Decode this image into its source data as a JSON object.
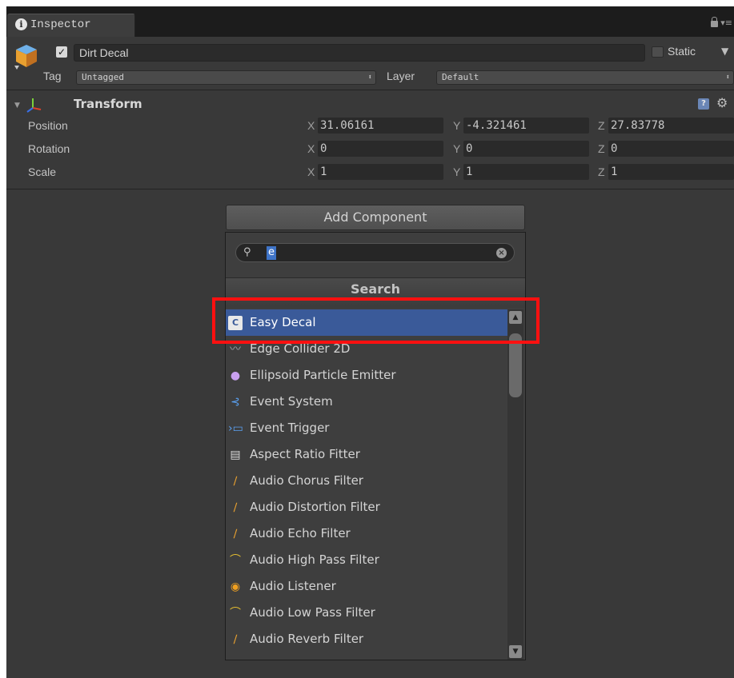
{
  "tab": {
    "title": "Inspector",
    "icon": "info-icon"
  },
  "object": {
    "name": "Dirt Decal",
    "active": true,
    "static_label": "Static",
    "static_checked": false
  },
  "tag": {
    "label": "Tag",
    "value": "Untagged"
  },
  "layer": {
    "label": "Layer",
    "value": "Default"
  },
  "transform": {
    "title": "Transform",
    "rows": [
      {
        "label": "Position",
        "x": "31.06161",
        "y": "-4.321461",
        "z": "27.83778"
      },
      {
        "label": "Rotation",
        "x": "0",
        "y": "0",
        "z": "0"
      },
      {
        "label": "Scale",
        "x": "1",
        "y": "1",
        "z": "1"
      }
    ],
    "axes": [
      "X",
      "Y",
      "Z"
    ]
  },
  "add_component": {
    "button_label": "Add Component",
    "search_value": "e",
    "header": "Search",
    "results": [
      {
        "label": "Easy Decal",
        "icon": "csharp-script-icon",
        "selected": true
      },
      {
        "label": "Edge Collider 2D",
        "icon": "edge-collider-icon"
      },
      {
        "label": "Ellipsoid Particle Emitter",
        "icon": "particle-emitter-icon"
      },
      {
        "label": "Event System",
        "icon": "event-system-icon"
      },
      {
        "label": "Event Trigger",
        "icon": "event-trigger-icon"
      },
      {
        "label": "Aspect Ratio Fitter",
        "icon": "aspect-ratio-icon"
      },
      {
        "label": "Audio Chorus Filter",
        "icon": "audio-chorus-icon"
      },
      {
        "label": "Audio Distortion Filter",
        "icon": "audio-distortion-icon"
      },
      {
        "label": "Audio Echo Filter",
        "icon": "audio-echo-icon"
      },
      {
        "label": "Audio High Pass Filter",
        "icon": "audio-high-pass-icon"
      },
      {
        "label": "Audio Listener",
        "icon": "audio-listener-icon"
      },
      {
        "label": "Audio Low Pass Filter",
        "icon": "audio-low-pass-icon"
      },
      {
        "label": "Audio Reverb Filter",
        "icon": "audio-reverb-icon"
      }
    ]
  },
  "colors": {
    "highlight": "#ff1010",
    "selection": "#3a5a99",
    "panel": "#393939"
  }
}
